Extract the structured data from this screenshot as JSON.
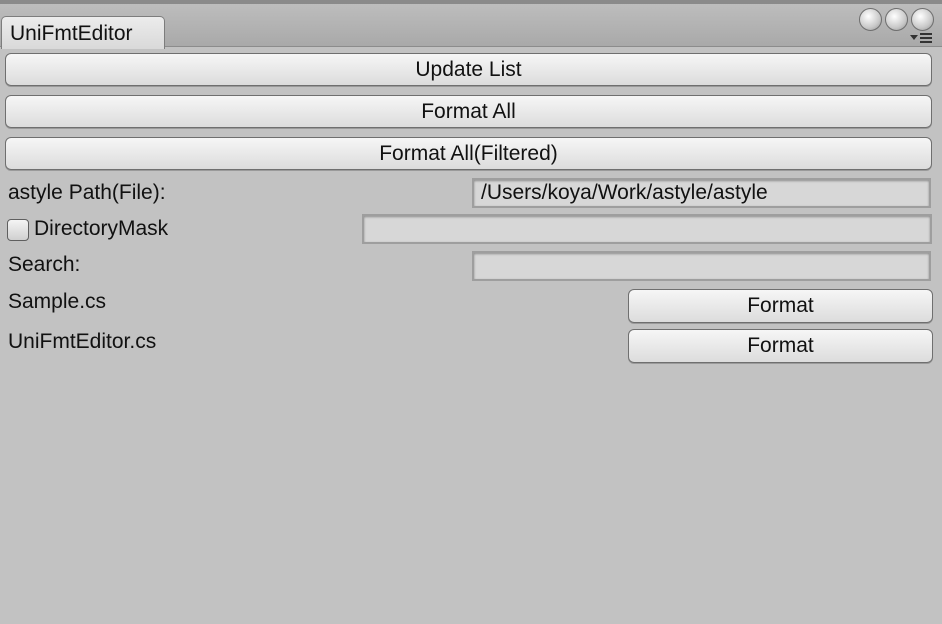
{
  "window": {
    "tab_title": "UniFmtEditor",
    "controls": [
      "window-control-icon",
      "window-control-icon",
      "window-control-icon"
    ],
    "menu_icon": "dropdown-menu-icon"
  },
  "toolbar": {
    "update_list": "Update List",
    "format_all": "Format All",
    "format_all_filtered": "Format All(Filtered)"
  },
  "settings": {
    "astyle_path_label": "astyle Path(File):",
    "astyle_path_value": "/Users/koya/Work/astyle/astyle",
    "directory_mask_label": "DirectoryMask",
    "directory_mask_checked": false,
    "directory_mask_value": "",
    "search_label": "Search:",
    "search_value": ""
  },
  "files": [
    {
      "name": "Sample.cs",
      "action": "Format"
    },
    {
      "name": "UniFmtEditor.cs",
      "action": "Format"
    }
  ]
}
